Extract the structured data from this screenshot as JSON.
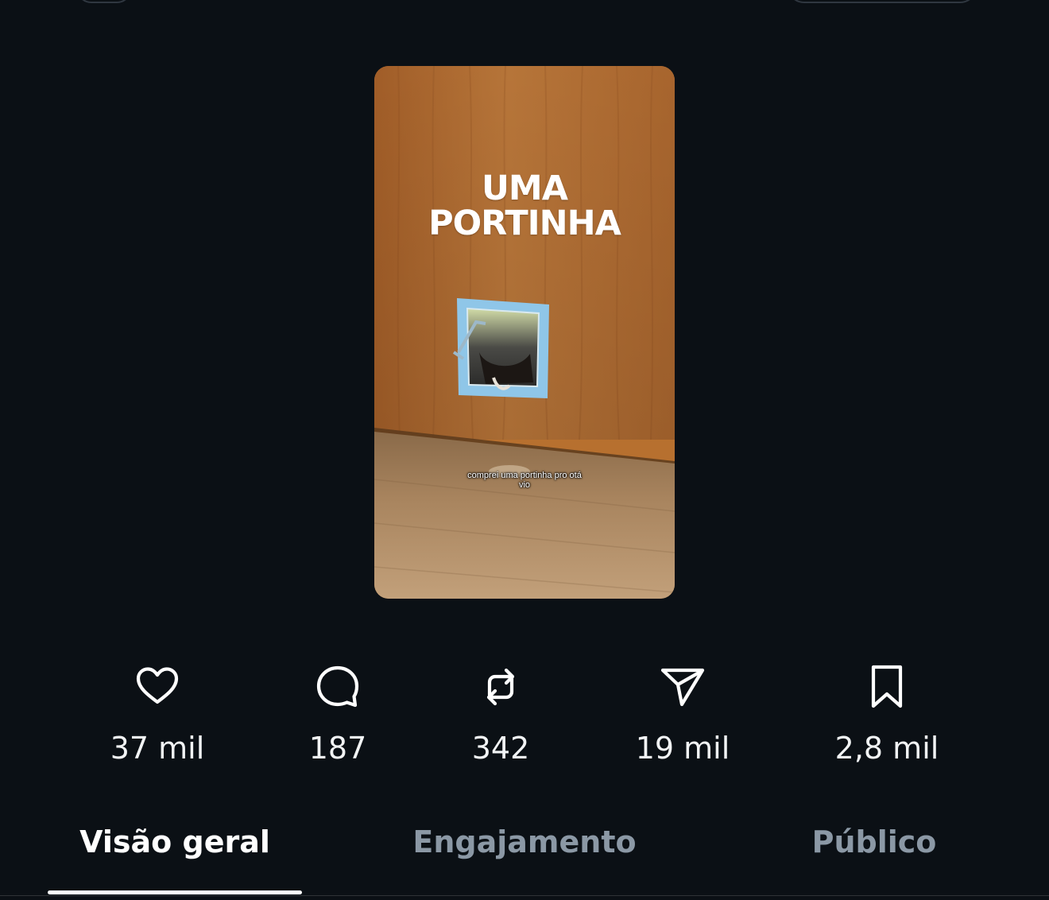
{
  "video": {
    "overlay_title_line1": "UMA",
    "overlay_title_line2": "PORTINHA",
    "caption_line1": "comprei uma portinha pro otá",
    "caption_line2": "vio"
  },
  "stats": [
    {
      "icon": "heart-icon",
      "value": "37 mil"
    },
    {
      "icon": "reply-icon",
      "value": "187"
    },
    {
      "icon": "repost-icon",
      "value": "342"
    },
    {
      "icon": "share-icon",
      "value": "19 mil"
    },
    {
      "icon": "bookmark-icon",
      "value": "2,8 mil"
    }
  ],
  "tabs": [
    {
      "label": "Visão geral",
      "active": true
    },
    {
      "label": "Engajamento",
      "active": false
    },
    {
      "label": "Público",
      "active": false
    }
  ],
  "colors": {
    "background": "#0b1015",
    "text_primary": "#ffffff",
    "text_secondary": "#8b98a5",
    "door_wood": "#b7702f",
    "floor_wood": "#a8845e",
    "pet_door_frame": "#8fc6e8"
  }
}
